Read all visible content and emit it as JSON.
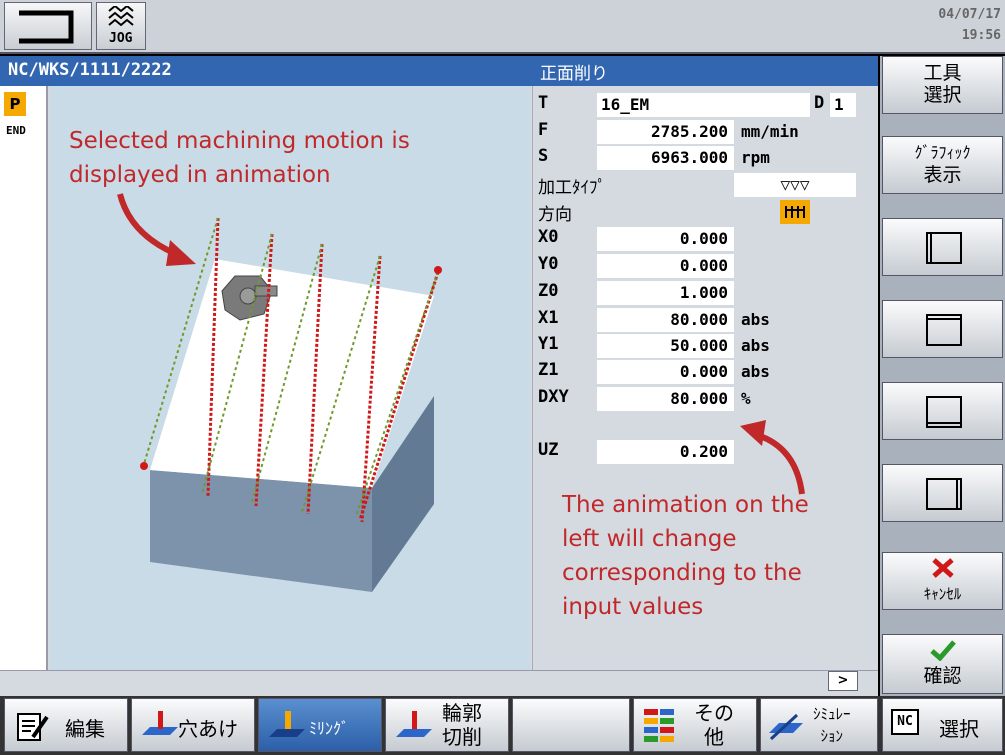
{
  "header": {
    "mode_label": "JOG",
    "date": "04/07/17",
    "time": "19:56"
  },
  "title": {
    "path": "NC/WKS/1111/2222",
    "cycle": "正面削り"
  },
  "program": {
    "p_label": "P",
    "end_label": "END"
  },
  "params": {
    "T": {
      "label": "T",
      "value": "16_EM",
      "d_label": "D",
      "d_value": "1"
    },
    "F": {
      "label": "F",
      "value": "2785.200",
      "unit": "mm/min"
    },
    "S": {
      "label": "S",
      "value": "6963.000",
      "unit": "rpm"
    },
    "machining_type": {
      "label": "加工ﾀｲﾌﾟ",
      "value": "▽▽▽"
    },
    "direction": {
      "label": "方向"
    },
    "X0": {
      "label": "X0",
      "value": "0.000"
    },
    "Y0": {
      "label": "Y0",
      "value": "0.000"
    },
    "Z0": {
      "label": "Z0",
      "value": "1.000"
    },
    "X1": {
      "label": "X1",
      "value": "80.000",
      "unit": "abs"
    },
    "Y1": {
      "label": "Y1",
      "value": "50.000",
      "unit": "abs"
    },
    "Z1": {
      "label": "Z1",
      "value": "0.000",
      "unit": "abs"
    },
    "DXY": {
      "label": "DXY",
      "value": "80.000",
      "unit": "%"
    },
    "UZ": {
      "label": "UZ",
      "value": "0.200"
    }
  },
  "annotations": {
    "top": [
      "Selected machining motion is",
      "displayed in animation"
    ],
    "bottom": [
      "The animation on the",
      "left will change",
      "corresponding to the",
      "input values"
    ]
  },
  "status": {
    "arrow": ">"
  },
  "vertical_softkeys": {
    "tool_select": [
      "工具",
      "選択"
    ],
    "graphic_view": [
      "ｸﾞﾗﾌｨｯｸ",
      "表示"
    ],
    "cancel": "ｷｬﾝｾﾙ",
    "confirm": "確認"
  },
  "horizontal_softkeys": {
    "edit": "編集",
    "drilling": "穴あけ",
    "milling": "ﾐﾘﾝｸﾞ",
    "contour": [
      "輪郭",
      "切削"
    ],
    "other": [
      "その",
      "他"
    ],
    "simulation": [
      "ｼﾐｭﾚｰ",
      "ｼｮﾝ"
    ],
    "select": "選択",
    "nc_icon": "NC"
  },
  "colors": {
    "title_bar": "#3366b0",
    "accent_orange": "#f5a800",
    "annotation": "#c0282a",
    "cancel_x": "#d01818",
    "confirm_check": "#2a9a2a",
    "active_softkey": "#2c5fa8"
  }
}
